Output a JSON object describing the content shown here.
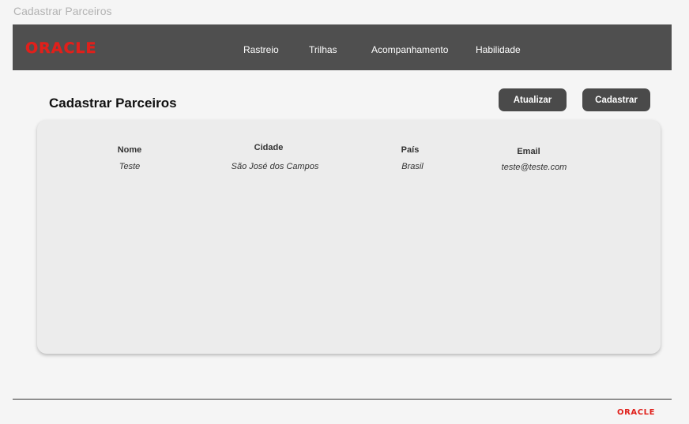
{
  "frame": {
    "title": "Cadastrar Parceiros"
  },
  "brand": {
    "logo_text": "ORACLE",
    "color": "#e0201b"
  },
  "nav": {
    "items": [
      {
        "label": "Rastreio"
      },
      {
        "label": "Trilhas"
      },
      {
        "label": "Acompanhamento"
      },
      {
        "label": "Habilidade"
      }
    ]
  },
  "main": {
    "title": "Cadastrar Parceiros",
    "update_label": "Atualizar",
    "register_label": "Cadastrar"
  },
  "table": {
    "columns": [
      "Nome",
      "Cidade",
      "País",
      "Email"
    ],
    "rows": [
      [
        "Teste",
        "São José dos Campos",
        "Brasil",
        "teste@teste.com"
      ]
    ]
  },
  "footer": {
    "logo_text": "ORACLE"
  },
  "colors": {
    "navbar": "#4f4f4f",
    "button": "#4a4a4a",
    "card": "#ececec",
    "background": "#f5f5f5"
  }
}
